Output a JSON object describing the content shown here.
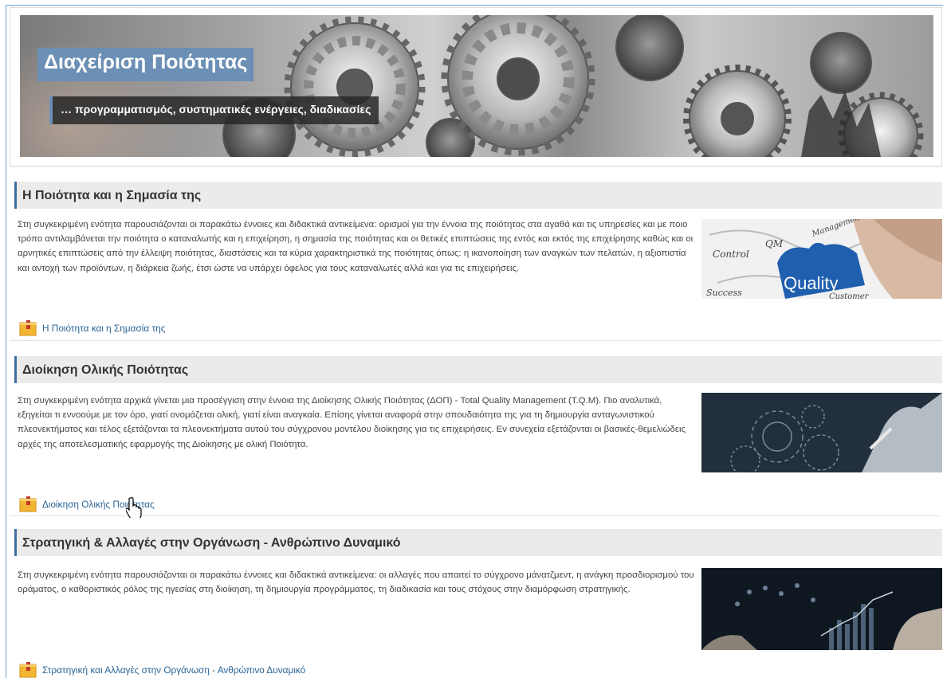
{
  "banner": {
    "title": "Διαχείριση Ποιότητας",
    "subtitle": "… προγραμματισμός, συστηματικές ενέργειες, διαδικασίες"
  },
  "sections": [
    {
      "heading": "Η Ποιότητα και η Σημασία της",
      "text": "Στη συγκεκριμένη ενότητα παρουσιάζονται οι παρακάτω έννοιες και διδακτικά αντικείμενα: ορισμοί για την έννοια της ποιότητας στα αγαθά και τις υπηρεσίες και με ποιο τρόπο αντιλαμβάνεται την ποιότητα ο καταναλωτής και η επιχείρηση, η σημασία της ποιότητας και οι θετικές επιπτώσεις της εντός και εκτός της επιχείρησης καθώς και οι αρνητικές επιπτώσεις από την έλλειψη ποιότητας, διαστάσεις και τα κύρια χαρακτηριστικά της ποιότητας όπως: η ικανοποίηση των αναγκών των πελατών, η αξιοπιστία και αντοχή των προϊόντων, η διάρκεια ζωής, έτσι ώστε να υπάρχει όφελος για τους καταναλωτές αλλά και για τις επιχειρήσεις.",
      "link": "Η Ποιότητα και η Σημασία της",
      "image_words": [
        "Control",
        "QM",
        "Management",
        "Quality",
        "Success",
        "Customer"
      ]
    },
    {
      "heading": "Διοίκηση Ολικής Ποιότητας",
      "text": "Στη συγκεκριμένη ενότητα αρχικά γίνεται μια προσέγγιση στην έννοια της Διοίκησης Ολικής Ποιότητας (ΔΟΠ) - Total Quality Management (T.Q.M). Πιο αναλυτικά, εξηγείται τι εννοούμε με τον όρο, γιατί ονομάζεται ολική, γιατί είναι αναγκαία. Επίσης γίνεται αναφορά στην σπουδαιότητα της για τη δημιουργία ανταγωνιστικού πλεονεκτήματος και τέλος εξετάζονται τα πλεονεκτήματα αυτού του σύγχρονου μοντέλου διοίκησης για τις επιχειρήσεις. Εν συνεχεία εξετάζονται οι βασικές-θεμελιώδεις αρχές της αποτελεσματικής εφαρμογής της Διοίκησης με ολική Ποιότητα.",
      "link": "Διοίκηση Ολικής Ποιότητας"
    },
    {
      "heading": "Στρατηγική & Αλλαγές στην Οργάνωση - Ανθρώπινο Δυναμικό",
      "text": "Στη συγκεκριμένη ενότητα παρουσιάζονται οι παρακάτω έννοιες και διδακτικά αντικείμενα: οι αλλαγές που απαιτεί το σύγχρονο μάνατζμεντ, η ανάγκη προσδιορισμού του οράματος, ο καθοριστικός ρόλος της ηγεσίας στη διοίκηση, τη δημιουργία προγράμματος, τη διαδικασία και τους στόχους στην διαμόρφωση στρατηγικής.",
      "link": "Στρατηγική και Αλλαγές στην Οργάνωση - Ανθρώπινο Δυναμικό"
    }
  ],
  "colors": {
    "accent": "#3f6e9e",
    "title_bg": "#6b8fb5",
    "link": "#2a6496",
    "icon": "#f2b632"
  }
}
